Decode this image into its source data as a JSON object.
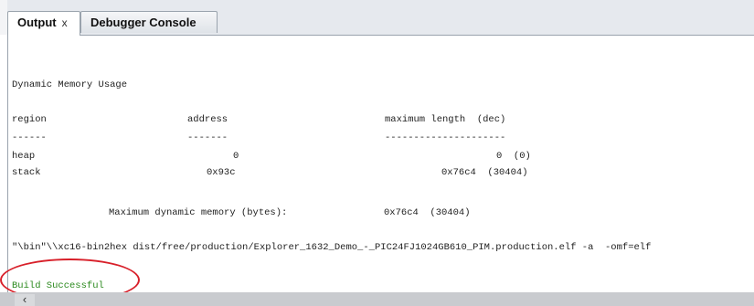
{
  "tabs": [
    {
      "label": "Output",
      "close": "x"
    },
    {
      "label": "Debugger Console"
    }
  ],
  "output": {
    "title": "Dynamic Memory Usage",
    "headers": {
      "region": "region",
      "address": "address",
      "maxlen": "maximum length  (dec)"
    },
    "dividers": {
      "region": "------",
      "address": "-------",
      "maxlen": "---------------------"
    },
    "rows": [
      {
        "region": "heap",
        "address": "0",
        "maxlen": "0  (0)"
      },
      {
        "region": "stack",
        "address": "0x93c",
        "maxlen": "0x76c4  (30404)"
      }
    ],
    "max_dynamic_label": "Maximum dynamic memory (bytes):",
    "max_dynamic_value": "0x76c4  (30404)",
    "command": "\"\\bin\"\\\\xc16-bin2hex dist/free/production/Explorer_1632_Demo_-_PIC24FJ1024GB610_PIM.production.elf -a  -omf=elf",
    "build_status": "Build Successful"
  },
  "colors": {
    "build_success": "#2c8a1f",
    "highlight": "#d8202a"
  },
  "icons": {
    "scroll_left": "chevron-left-icon"
  }
}
